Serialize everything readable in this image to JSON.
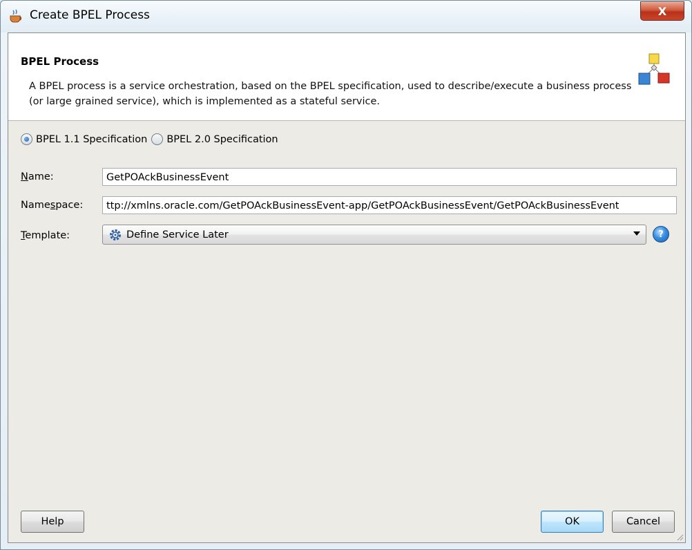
{
  "window": {
    "title": "Create BPEL Process",
    "close_label": "X"
  },
  "header": {
    "title": "BPEL Process",
    "description": "A BPEL process is a service orchestration, based on the BPEL specification, used to describe/execute a business process (or large grained service), which is implemented as a stateful service.",
    "icon": "process-diagram-icon"
  },
  "spec_options": [
    {
      "label": "BPEL 1.1 Specification",
      "selected": true
    },
    {
      "label": "BPEL 2.0 Specification",
      "selected": false
    }
  ],
  "form": {
    "name_label_mn": "N",
    "name_label_rest": "ame:",
    "name_value": "GetPOAckBusinessEvent",
    "namespace_label_pre": "Name",
    "namespace_label_mn": "s",
    "namespace_label_post": "pace:",
    "namespace_value": "ttp://xmlns.oracle.com/GetPOAckBusinessEvent-app/GetPOAckBusinessEvent/GetPOAckBusinessEvent",
    "template_label_mn": "T",
    "template_label_rest": "emplate:",
    "template_value": "Define Service Later",
    "template_icon": "gear-icon",
    "help_icon": "help-icon",
    "help_glyph": "?"
  },
  "buttons": {
    "help": "Help",
    "ok": "OK",
    "cancel": "Cancel"
  }
}
